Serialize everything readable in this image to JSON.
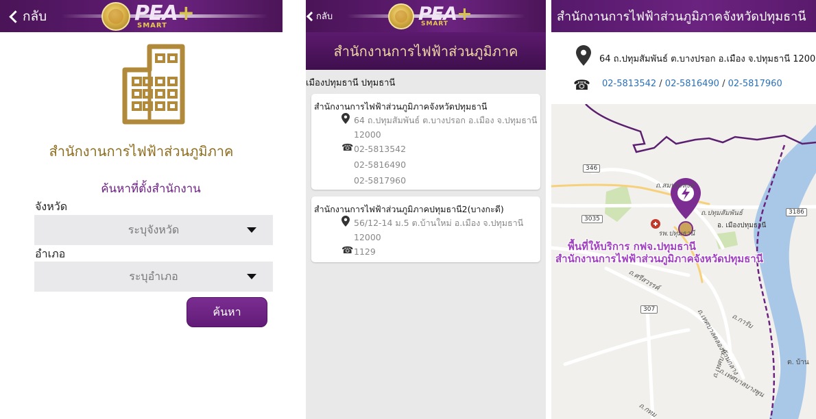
{
  "screen1": {
    "back_label": "กลับ",
    "logo_text": "PEA",
    "logo_plus": "+",
    "logo_sub": "SMART",
    "icon": "office-building-icon",
    "title": "สำนักงานการไฟฟ้าส่วนภูมิภาค",
    "subtitle": "ค้นหาที่ตั้งสำนักงาน",
    "province_label": "จังหวัด",
    "province_placeholder": "ระบุจังหวัด",
    "district_label": "อำเภอ",
    "district_placeholder": "ระบุอำเภอ",
    "search_button": "ค้นหา",
    "colors": {
      "header": "#5a1a6c",
      "gold": "#8d6c1e",
      "accent": "#6d1f84",
      "button": "#6e2486"
    }
  },
  "screen2": {
    "back_label": "กลับ",
    "logo_text": "PEA",
    "logo_plus": "+",
    "logo_sub": "SMART",
    "header_title": "สำนักงานการไฟฟ้าส่วนภูมิภาค",
    "district_line": "เมืองปทุมธานี ปทุมธานี",
    "offices": [
      {
        "name": "สำนักงานการไฟฟ้าส่วนภูมิภาคจังหวัดปทุมธานี",
        "address": "64 ถ.ปทุมสัมพันธ์ ต.บางปรอก อ.เมือง จ.ปทุมธานี",
        "postcode": "12000",
        "phones": [
          "02-5813542",
          "02-5816490",
          "02-5817960"
        ]
      },
      {
        "name": "สำนักงานการไฟฟ้าส่วนภูมิภาคปทุมธานี2(บางกะดี)",
        "address": "56/12-14 ม.5 ต.บ้านใหม่ อ.เมือง จ.ปทุมธานี",
        "postcode": "12000",
        "phones": [
          "1129"
        ]
      }
    ]
  },
  "screen3": {
    "header_title": "สำนักงานการไฟฟ้าส่วนภูมิภาคจังหวัดปทุมธานี",
    "address": "64 ถ.ปทุมสัมพันธ์ ต.บางปรอก อ.เมือง จ.ปทุมธานี 12000",
    "phones": [
      "02-5813542",
      "02-5816490",
      "02-5817960"
    ],
    "phone_separator": " / ",
    "map": {
      "overlay_line1": "พื้นที่ให้บริการ กฟจ.ปทุมธานี",
      "overlay_line2": "สำนักงานการไฟฟ้าส่วนภูมิภาคจังหวัดปทุมธานี",
      "labels": [
        "ถ.สมประสงค์",
        "ถ.ปทุมสัมพันธ์",
        "อ. เมืองปทุมธานี",
        "รพ.ปทุมธานี",
        "ถ.ศรีสวรรค์",
        "ถ.เทศบาลคลองบ้านกลาง",
        "ถ.เทศบาล",
        "ถ.การับ",
        "ต. บ้าน",
        "ถ.เทศบาลบางพูน",
        "ถ.กทม"
      ],
      "road_shields": [
        "346",
        "3035",
        "3186",
        "307"
      ],
      "pin_icon": "lightning-bolt-icon"
    }
  }
}
